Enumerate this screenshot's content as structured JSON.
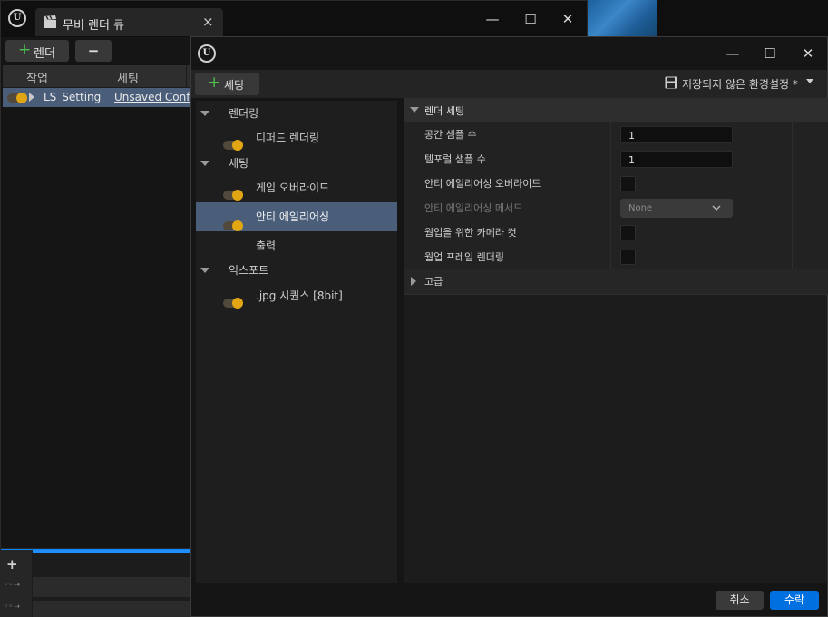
{
  "queue_window": {
    "tab_title": "무비 렌더 큐",
    "tab_close": "×",
    "render_button": "렌더",
    "remove_button": "−",
    "columns": [
      "작업",
      "세팅"
    ],
    "job": {
      "name": "LS_Setting",
      "config": "Unsaved Config"
    }
  },
  "settings_window": {
    "add_setting_button": "세팅",
    "preset_label": "저장되지 않은 환경설정 *",
    "tree": [
      {
        "type": "category",
        "label": "렌더링"
      },
      {
        "type": "item",
        "label": "디퍼드 렌더링",
        "toggle": true
      },
      {
        "type": "category",
        "label": "세팅"
      },
      {
        "type": "item",
        "label": "게임 오버라이드",
        "toggle": true
      },
      {
        "type": "item",
        "label": "안티 에일리어싱",
        "toggle": true,
        "selected": true
      },
      {
        "type": "item",
        "label": "출력",
        "toggle": false
      },
      {
        "type": "category",
        "label": "익스포트"
      },
      {
        "type": "item",
        "label": ".jpg 시퀀스 [8bit]",
        "toggle": true
      }
    ],
    "details": {
      "section": "렌더 세팅",
      "rows": [
        {
          "label": "공간 샘플 수",
          "kind": "number",
          "value": "1"
        },
        {
          "label": "템포럴 샘플 수",
          "kind": "number",
          "value": "1"
        },
        {
          "label": "안티 에일리어싱 오버라이드",
          "kind": "checkbox",
          "checked": false
        },
        {
          "label": "안티 에일리어싱 메서드",
          "kind": "dropdown",
          "value": "None",
          "disabled": true
        },
        {
          "label": "웜업을 위한 카메라 컷",
          "kind": "checkbox",
          "checked": false
        },
        {
          "label": "웜업 프레임 렌더링",
          "kind": "checkbox",
          "checked": false
        }
      ],
      "advanced": "고급"
    },
    "cancel_button": "취소",
    "accept_button": "수락"
  },
  "colors": {
    "accent": "#0070e0",
    "toggle_on": "#e2a514",
    "selection": "#4a5e7a"
  },
  "icons": [
    "unreal-logo-icon",
    "clapperboard-icon",
    "plus-icon",
    "save-icon",
    "chevron-down-icon"
  ]
}
